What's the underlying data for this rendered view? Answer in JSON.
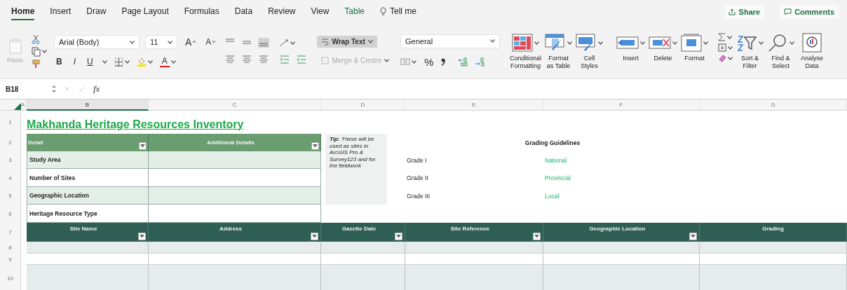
{
  "tabs": [
    {
      "label": "Home",
      "selected": true,
      "kind": "tab"
    },
    {
      "label": "Insert",
      "selected": false,
      "kind": "tab"
    },
    {
      "label": "Draw",
      "selected": false,
      "kind": "tab"
    },
    {
      "label": "Page Layout",
      "selected": false,
      "kind": "tab"
    },
    {
      "label": "Formulas",
      "selected": false,
      "kind": "tab"
    },
    {
      "label": "Data",
      "selected": false,
      "kind": "tab"
    },
    {
      "label": "Review",
      "selected": false,
      "kind": "tab"
    },
    {
      "label": "View",
      "selected": false,
      "kind": "tab"
    },
    {
      "label": "Table",
      "selected": false,
      "kind": "contextual"
    },
    {
      "label": "Tell me",
      "selected": false,
      "kind": "search"
    }
  ],
  "actions": {
    "share": "Share",
    "comments": "Comments"
  },
  "ribbon": {
    "paste": {
      "label": "Paste",
      "disabled": true
    },
    "font": "Arial (Body)",
    "size": "11",
    "grow": "A",
    "shrink": "A",
    "styles": [
      "B",
      "I",
      "U"
    ],
    "font_color": "A",
    "align_bottom_on": true,
    "wrap_text": {
      "label": "Wrap Text",
      "on": true
    },
    "merge": {
      "label": "Merge & Centre",
      "disabled": true
    },
    "number_format": "General",
    "percent": "%",
    "big_buttons": [
      {
        "kind": "conditional",
        "lines": [
          "Conditional",
          "Formatting"
        ]
      },
      {
        "kind": "table",
        "lines": [
          "Format",
          "as Table"
        ]
      },
      {
        "kind": "styles",
        "lines": [
          "Cell",
          "Styles"
        ]
      },
      {
        "kind": "insert",
        "lines": [
          "Insert"
        ]
      },
      {
        "kind": "delete",
        "lines": [
          "Delete"
        ]
      },
      {
        "kind": "format",
        "lines": [
          "Format"
        ]
      },
      {
        "kind": "sort",
        "lines": [
          "Sort &",
          "Filter"
        ]
      },
      {
        "kind": "find",
        "lines": [
          "Find &",
          "Select"
        ]
      },
      {
        "kind": "analyse",
        "lines": [
          "Analyse",
          "Data"
        ]
      }
    ]
  },
  "formula_bar": {
    "name_box": "B18",
    "fx": "fx"
  },
  "column_headers": [
    {
      "label": "A",
      "selected": false
    },
    {
      "label": "B",
      "selected": true
    },
    {
      "label": "C",
      "selected": false
    },
    {
      "label": "D",
      "selected": false
    },
    {
      "label": "E",
      "selected": false
    },
    {
      "label": "F",
      "selected": false
    },
    {
      "label": "G",
      "selected": false
    }
  ],
  "row_headers": [
    "1",
    "2",
    "3",
    "4",
    "5",
    "6",
    "7",
    "8",
    "9",
    "10"
  ],
  "title": "Makhanda Heritage Resources Inventory",
  "summary_table": {
    "columns": [
      "Detail",
      "Additional Details"
    ],
    "rows": [
      "Study Area",
      "Number of Sites",
      "Geographic Location",
      "Heritage Resource Type"
    ]
  },
  "tip": "**Tip:** These will be used as sites in ArcGIS Pro & Survey123 and  for the fieldwork",
  "grading": {
    "title": "Grading Guidelines",
    "rows": [
      {
        "grade": "Grade I",
        "scope": "National"
      },
      {
        "grade": "Grade II",
        "scope": "Provincial"
      },
      {
        "grade": "Grade III",
        "scope": "Local"
      }
    ]
  },
  "sites_table": {
    "columns": [
      {
        "label": "Site Name",
        "filter": true
      },
      {
        "label": "Address",
        "filter": true
      },
      {
        "label": "Gazette Date",
        "filter": true
      },
      {
        "label": "Site Reference",
        "filter": true
      },
      {
        "label": "Geographic Location",
        "filter": true
      },
      {
        "label": "Grading",
        "filter": false
      }
    ]
  }
}
